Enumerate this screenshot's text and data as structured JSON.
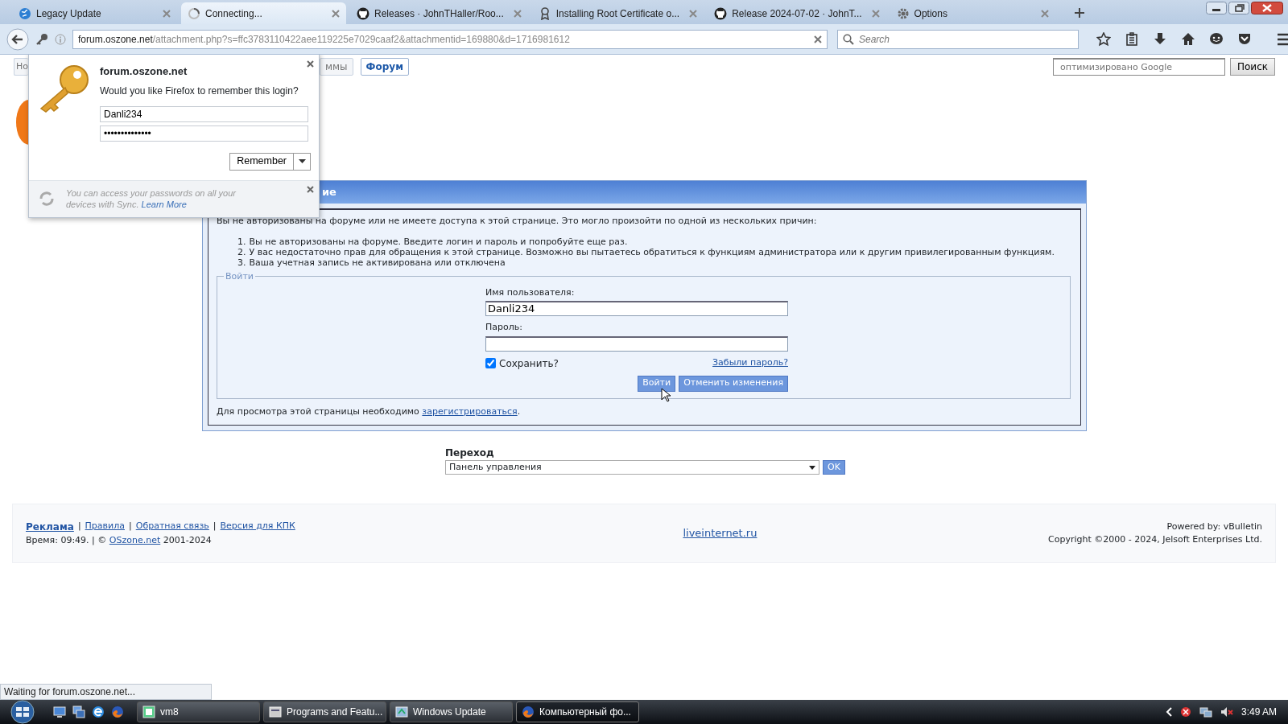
{
  "browser": {
    "tabs": [
      {
        "title": "Legacy Update",
        "selected": false,
        "kind": "globe"
      },
      {
        "title": "Connecting...",
        "selected": true,
        "kind": "spinner"
      },
      {
        "title": "Releases · JohnTHaller/Roo...",
        "selected": false,
        "kind": "github"
      },
      {
        "title": "Installing Root Certificate o...",
        "selected": false,
        "kind": "cert"
      },
      {
        "title": "Release 2024-07-02 · JohnT...",
        "selected": false,
        "kind": "github"
      },
      {
        "title": "Options",
        "selected": false,
        "kind": "gear"
      }
    ],
    "url": {
      "host": "forum.oszone.net",
      "path": "/attachment.php?s=ffc3783110422aee119225e7029caaf2&attachmentid=169880&d=1716981612"
    },
    "search": {
      "placeholder": "Search"
    }
  },
  "page": {
    "nav_tabs": [
      {
        "label": "Но",
        "selected": false
      },
      {
        "label": "ммы",
        "selected": false
      },
      {
        "label": "Форум",
        "selected": true
      }
    ],
    "google_search": {
      "placeholder": "оптимизировано Google"
    },
    "search_button": "Поиск",
    "notice": {
      "title": "ие",
      "intro": "Вы не авторизованы на форуме или не имеете доступа к этой странице. Это могло произойти по одной из нескольких причин:",
      "reasons": [
        {
          "marker": "1.",
          "text": "Вы не авторизованы на форуме. Введите логин и пароль и попробуйте еще раз."
        },
        {
          "marker": "2.",
          "text": "У вас недостаточно прав для обращения к этой странице. Возможно вы пытаетесь обратиться к функциям администратора или к другим привилегированным функциям."
        },
        {
          "marker": "3.",
          "text": "Ваша учетная запись не активирована или отключена"
        }
      ],
      "login_form": {
        "legend": "Войти",
        "username_label": "Имя пользователя:",
        "username": "Danli234",
        "password_label": "Пароль:",
        "remember": {
          "label": "Сохранить?",
          "checked": true
        },
        "forgot_link": "Забыли пароль?",
        "submit": "Войти",
        "reset": "Отменить изменения"
      },
      "register": {
        "before": "Для просмотра этой страницы необходимо ",
        "link": "зарегистрироваться",
        "after": "."
      }
    },
    "jump": {
      "label": "Переход",
      "selected": "Панель управления",
      "button": "OK"
    },
    "footer": {
      "links": [
        {
          "label": "Реклама",
          "bold": true
        },
        {
          "label": "Правила",
          "bold": false
        },
        {
          "label": "Обратная связь",
          "bold": false
        },
        {
          "label": "Версия для КПК",
          "bold": false
        }
      ],
      "separator": "|",
      "time_line": {
        "before": "Время: 09:49. | © ",
        "link": "OSzone.net",
        "after": " 2001-2024"
      },
      "center_link": "liveinternet.ru",
      "powered": "Powered by: vBulletin",
      "copyright": "Copyright ©2000 - 2024, Jelsoft Enterprises Ltd."
    }
  },
  "login_popup": {
    "site": "forum.oszone.net",
    "question": "Would you like Firefox to remember this login?",
    "username": "Danli234",
    "password": "••••••••••••••",
    "remember_button": "Remember",
    "sync_text": "You can access your passwords on all your devices with Sync.",
    "learn_more": "Learn More"
  },
  "status_text": "Waiting for forum.oszone.net...",
  "taskbar": {
    "items": [
      {
        "label": "vm8",
        "selected": false,
        "kind": "vm"
      },
      {
        "label": "Programs and Featu...",
        "selected": false,
        "kind": "programs"
      },
      {
        "label": "Windows Update",
        "selected": false,
        "kind": "update"
      },
      {
        "label": "Компьютерный фо...",
        "selected": true,
        "kind": "firefox"
      }
    ],
    "clock": "3:49 AM"
  }
}
